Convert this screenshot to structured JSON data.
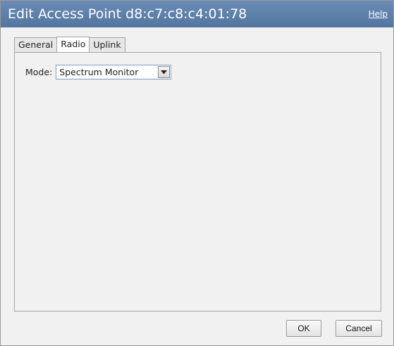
{
  "dialog": {
    "title": "Edit Access Point d8:c7:c8:c4:01:78",
    "help_label": "Help"
  },
  "tabs": [
    {
      "label": "General",
      "active": false
    },
    {
      "label": "Radio",
      "active": true
    },
    {
      "label": "Uplink",
      "active": false
    }
  ],
  "radio": {
    "mode_label": "Mode:",
    "mode_value": "Spectrum Monitor"
  },
  "buttons": {
    "ok_label": "OK",
    "cancel_label": "Cancel"
  },
  "colors": {
    "title_bar": "#5a7ea9",
    "panel_bg": "#f1f1f1"
  }
}
